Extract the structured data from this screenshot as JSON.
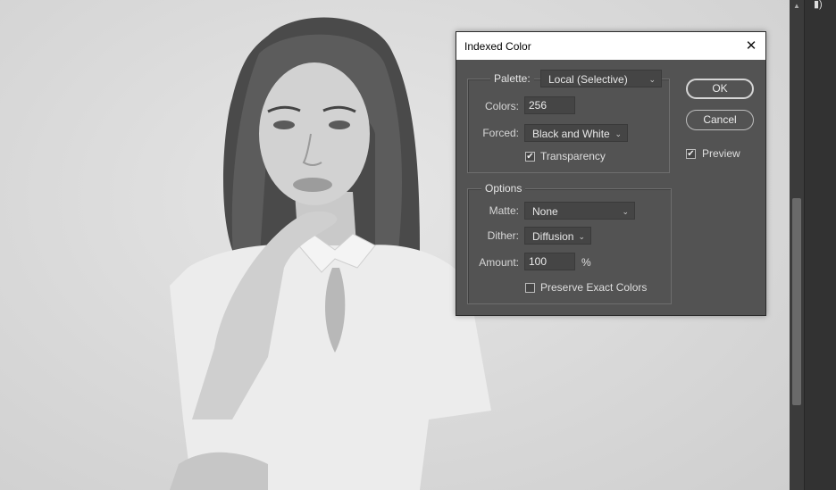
{
  "dialog": {
    "title": "Indexed Color",
    "palette": {
      "label": "Palette:",
      "value": "Local (Selective)"
    },
    "colors": {
      "label": "Colors:",
      "value": "256"
    },
    "forced": {
      "label": "Forced:",
      "value": "Black and White"
    },
    "transparency": {
      "label": "Transparency",
      "checked": true
    },
    "options": {
      "legend": "Options",
      "matte": {
        "label": "Matte:",
        "value": "None"
      },
      "dither": {
        "label": "Dither:",
        "value": "Diffusion"
      },
      "amount": {
        "label": "Amount:",
        "value": "100",
        "unit": "%"
      },
      "preserve": {
        "label": "Preserve Exact Colors",
        "checked": false
      }
    },
    "ok_label": "OK",
    "cancel_label": "Cancel",
    "preview": {
      "label": "Preview",
      "checked": true
    }
  },
  "icons": {
    "close": "close-icon",
    "chevron": "chevron-down-icon",
    "check": "checkmark-icon"
  },
  "glyphs": {
    "close": "✕",
    "chevron": "⌄",
    "check": "✔",
    "up": "▲",
    "panel": "▮)"
  }
}
